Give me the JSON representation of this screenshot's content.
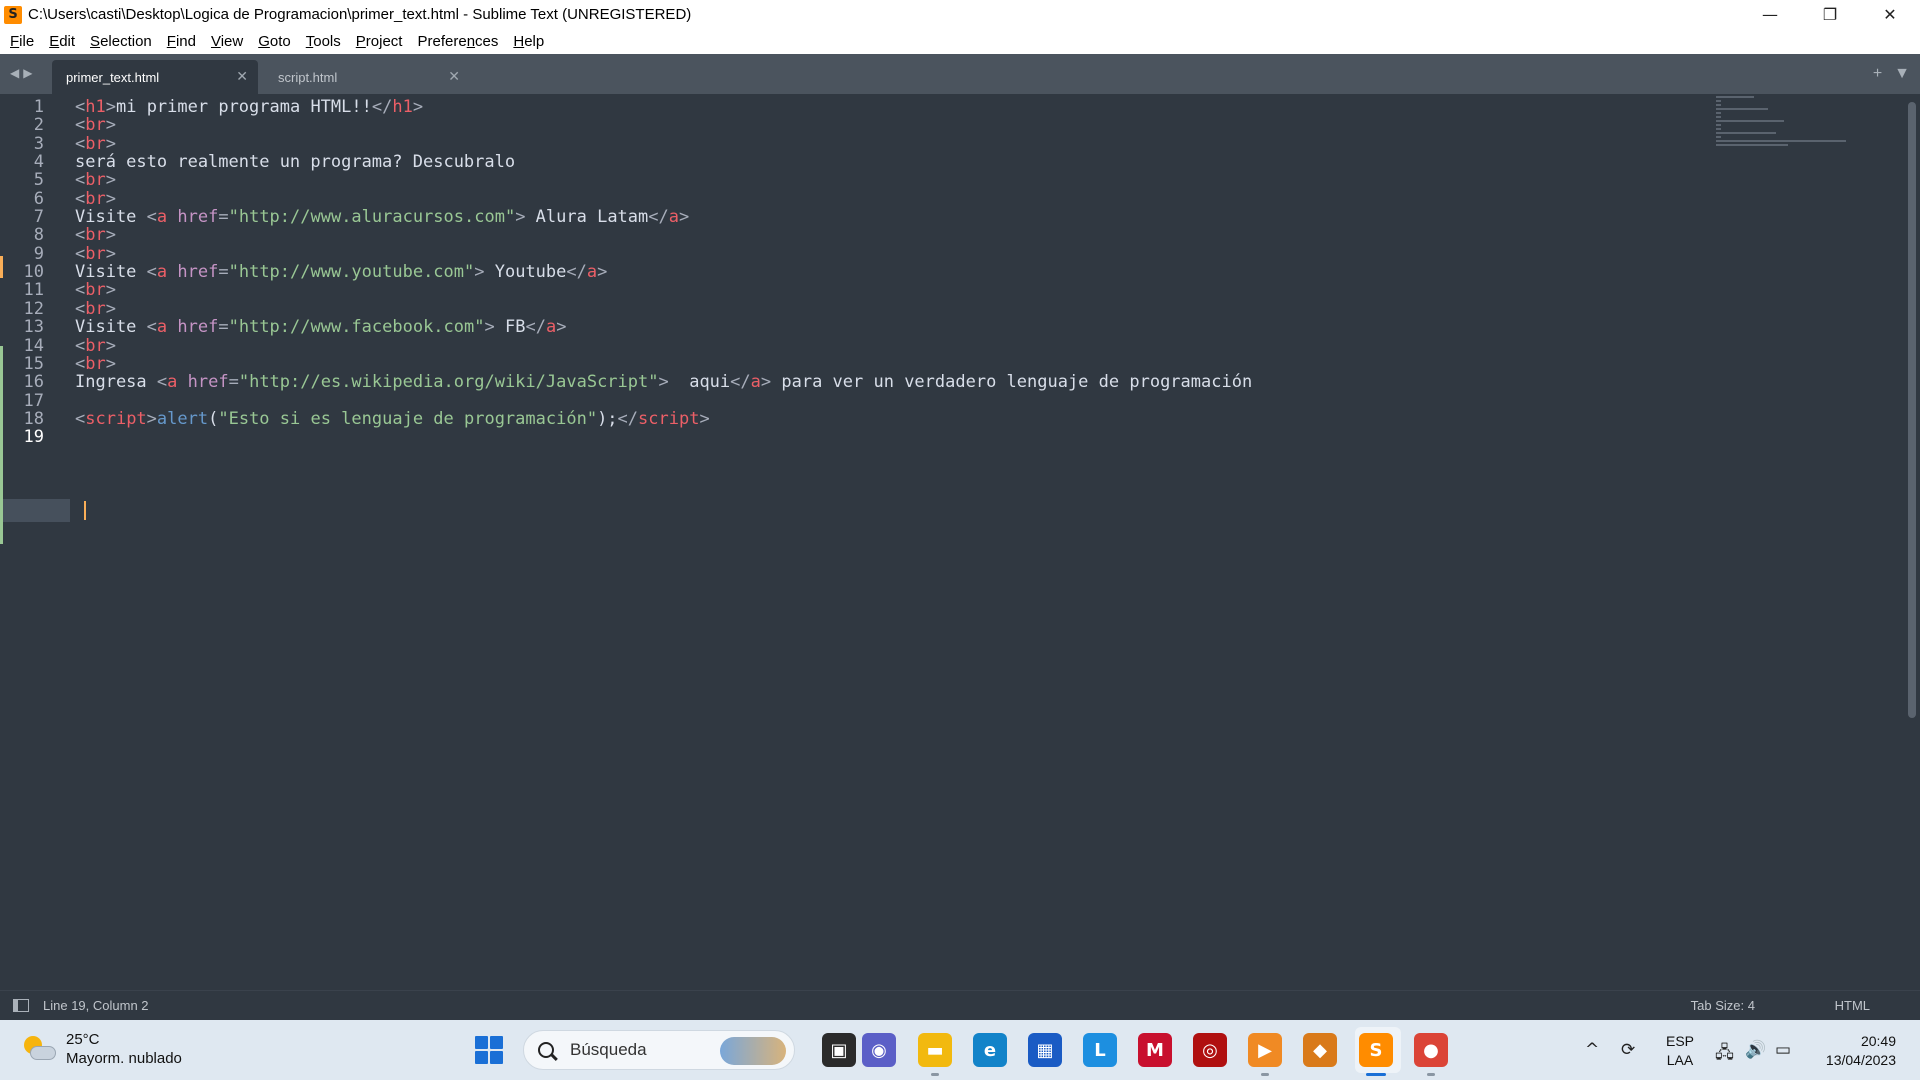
{
  "window": {
    "title": "C:\\Users\\casti\\Desktop\\Logica de Programacion\\primer_text.html - Sublime Text (UNREGISTERED)",
    "icon_glyph": "S",
    "minimize_glyph": "—",
    "maximize_glyph": "❐",
    "close_glyph": "✕"
  },
  "menu": [
    {
      "label": "File",
      "ul": "F",
      "rest": "ile"
    },
    {
      "label": "Edit",
      "ul": "E",
      "rest": "dit"
    },
    {
      "label": "Selection",
      "ul": "S",
      "rest": "election"
    },
    {
      "label": "Find",
      "ul": "F",
      "rest": "ind"
    },
    {
      "label": "View",
      "ul": "V",
      "rest": "iew"
    },
    {
      "label": "Goto",
      "ul": "G",
      "rest": "oto"
    },
    {
      "label": "Tools",
      "ul": "T",
      "rest": "ools"
    },
    {
      "label": "Project",
      "ul": "P",
      "rest": "roject"
    },
    {
      "label": "Preferences",
      "ul": "n",
      "pre": "Prefere",
      "rest": "ces"
    },
    {
      "label": "Help",
      "ul": "H",
      "rest": "elp"
    }
  ],
  "tabs": {
    "nav_left": "◀",
    "nav_right": "▶",
    "active": {
      "label": "primer_text.html",
      "close": "✕"
    },
    "inactive": {
      "label": "script.html",
      "close": "✕"
    },
    "new_tab": "+",
    "dropdown": "▼"
  },
  "editor": {
    "current_line": 19,
    "lines": [
      {
        "n": "1",
        "tokens": [
          [
            "p",
            "<"
          ],
          [
            "tag",
            "h1"
          ],
          [
            "p",
            ">"
          ],
          [
            "t",
            "mi primer programa HTML!!"
          ],
          [
            "p",
            "</"
          ],
          [
            "tag",
            "h1"
          ],
          [
            "p",
            ">"
          ]
        ]
      },
      {
        "n": "2",
        "tokens": [
          [
            "p",
            "<"
          ],
          [
            "tag",
            "br"
          ],
          [
            "p",
            ">"
          ]
        ]
      },
      {
        "n": "3",
        "tokens": [
          [
            "p",
            "<"
          ],
          [
            "tag",
            "br"
          ],
          [
            "p",
            ">"
          ]
        ]
      },
      {
        "n": "4",
        "tokens": [
          [
            "t",
            "será esto realmente un programa? Descubralo"
          ]
        ]
      },
      {
        "n": "5",
        "tokens": [
          [
            "p",
            "<"
          ],
          [
            "tag",
            "br"
          ],
          [
            "p",
            ">"
          ]
        ]
      },
      {
        "n": "6",
        "tokens": [
          [
            "p",
            "<"
          ],
          [
            "tag",
            "br"
          ],
          [
            "p",
            ">"
          ]
        ]
      },
      {
        "n": "7",
        "tokens": [
          [
            "t",
            "Visite "
          ],
          [
            "p",
            "<"
          ],
          [
            "tag",
            "a"
          ],
          [
            "t",
            " "
          ],
          [
            "attr",
            "href"
          ],
          [
            "p",
            "="
          ],
          [
            "str",
            "\"http://www.aluracursos.com\""
          ],
          [
            "p",
            ">"
          ],
          [
            "t",
            " Alura Latam"
          ],
          [
            "p",
            "</"
          ],
          [
            "tag",
            "a"
          ],
          [
            "p",
            ">"
          ]
        ]
      },
      {
        "n": "8",
        "tokens": [
          [
            "p",
            "<"
          ],
          [
            "tag",
            "br"
          ],
          [
            "p",
            ">"
          ]
        ]
      },
      {
        "n": "9",
        "tokens": [
          [
            "p",
            "<"
          ],
          [
            "tag",
            "br"
          ],
          [
            "p",
            ">"
          ]
        ]
      },
      {
        "n": "10",
        "tokens": [
          [
            "t",
            "Visite "
          ],
          [
            "p",
            "<"
          ],
          [
            "tag",
            "a"
          ],
          [
            "t",
            " "
          ],
          [
            "attr",
            "href"
          ],
          [
            "p",
            "="
          ],
          [
            "str",
            "\"http://www.youtube.com\""
          ],
          [
            "p",
            ">"
          ],
          [
            "t",
            " Youtube"
          ],
          [
            "p",
            "</"
          ],
          [
            "tag",
            "a"
          ],
          [
            "p",
            ">"
          ]
        ]
      },
      {
        "n": "11",
        "tokens": [
          [
            "p",
            "<"
          ],
          [
            "tag",
            "br"
          ],
          [
            "p",
            ">"
          ]
        ]
      },
      {
        "n": "12",
        "tokens": [
          [
            "p",
            "<"
          ],
          [
            "tag",
            "br"
          ],
          [
            "p",
            ">"
          ]
        ]
      },
      {
        "n": "13",
        "tokens": [
          [
            "t",
            "Visite "
          ],
          [
            "p",
            "<"
          ],
          [
            "tag",
            "a"
          ],
          [
            "t",
            " "
          ],
          [
            "attr",
            "href"
          ],
          [
            "p",
            "="
          ],
          [
            "str",
            "\"http://www.facebook.com\""
          ],
          [
            "p",
            ">"
          ],
          [
            "t",
            " FB"
          ],
          [
            "p",
            "</"
          ],
          [
            "tag",
            "a"
          ],
          [
            "p",
            ">"
          ]
        ]
      },
      {
        "n": "14",
        "tokens": [
          [
            "p",
            "<"
          ],
          [
            "tag",
            "br"
          ],
          [
            "p",
            ">"
          ]
        ]
      },
      {
        "n": "15",
        "tokens": [
          [
            "p",
            "<"
          ],
          [
            "tag",
            "br"
          ],
          [
            "p",
            ">"
          ]
        ]
      },
      {
        "n": "16",
        "tokens": [
          [
            "t",
            "Ingresa "
          ],
          [
            "p",
            "<"
          ],
          [
            "tag",
            "a"
          ],
          [
            "t",
            " "
          ],
          [
            "attr",
            "href"
          ],
          [
            "p",
            "="
          ],
          [
            "str",
            "\"http://es.wikipedia.org/wiki/JavaScript\""
          ],
          [
            "p",
            ">"
          ],
          [
            "t",
            "  aqui"
          ],
          [
            "p",
            "</"
          ],
          [
            "tag",
            "a"
          ],
          [
            "p",
            ">"
          ],
          [
            "t",
            " para ver un verdadero lenguaje de programación"
          ]
        ]
      },
      {
        "n": "17",
        "tokens": []
      },
      {
        "n": "18",
        "tokens": [
          [
            "p",
            "<"
          ],
          [
            "tag",
            "script"
          ],
          [
            "p",
            ">"
          ],
          [
            "fn",
            "alert"
          ],
          [
            "t",
            "("
          ],
          [
            "str",
            "\"Esto si es lenguaje de programación\""
          ],
          [
            "t",
            ");"
          ],
          [
            "p",
            "</"
          ],
          [
            "tag",
            "script"
          ],
          [
            "p",
            ">"
          ]
        ]
      },
      {
        "n": "19",
        "tokens": []
      }
    ],
    "colors": {
      "background": "#303841",
      "tag": "#ec5f67",
      "attr": "#c594c5",
      "string": "#99c794",
      "function": "#6699cc",
      "text": "#d8dee9",
      "caret": "#f9ae58",
      "modified_marker": "#f9ae58",
      "added_marker": "#99c794"
    }
  },
  "status_bar": {
    "position": "Line 19, Column 2",
    "tab_size": "Tab Size: 4",
    "syntax": "HTML"
  },
  "taskbar": {
    "weather_temp": "25°C",
    "weather_desc": "Mayorm. nublado",
    "search_placeholder": "Búsqueda",
    "apps": [
      {
        "name": "task-view-icon",
        "glyph": "▣",
        "color": "#2b2b2b"
      },
      {
        "name": "chat-icon",
        "glyph": "◉",
        "color": "#5b5fc7"
      },
      {
        "name": "file-explorer-icon",
        "glyph": "▬",
        "color": "#f2b90f"
      },
      {
        "name": "edge-icon",
        "glyph": "e",
        "color": "#1283c9"
      },
      {
        "name": "store-icon",
        "glyph": "▦",
        "color": "#1a5bc4"
      },
      {
        "name": "l-app-icon",
        "glyph": "L",
        "color": "#1d8fe0"
      },
      {
        "name": "mcafee-icon",
        "glyph": "M",
        "color": "#c8102e"
      },
      {
        "name": "red-app-icon",
        "glyph": "◎",
        "color": "#b01010"
      },
      {
        "name": "media-player-icon",
        "glyph": "▶",
        "color": "#f08a24"
      },
      {
        "name": "game-app-icon",
        "glyph": "◆",
        "color": "#d97a1a"
      },
      {
        "name": "sublime-text-icon",
        "glyph": "S",
        "color": "#ff8c00"
      },
      {
        "name": "chrome-icon",
        "glyph": "●",
        "color": "#db4437"
      }
    ],
    "tray_chevron": "^",
    "tray_sync": "⟳",
    "lang_1": "ESP",
    "lang_2": "LAA",
    "network": "🖧",
    "volume": "🔊",
    "battery": "▭",
    "time": "20:49",
    "date": "13/04/2023"
  }
}
